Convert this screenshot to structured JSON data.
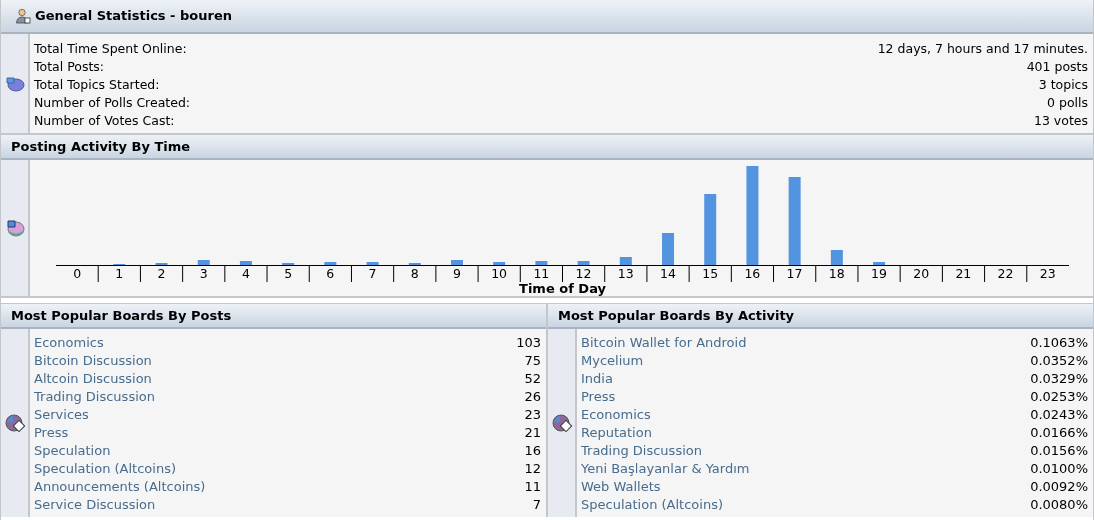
{
  "general": {
    "title": "General Statistics - bouren",
    "rows": [
      {
        "label": "Total Time Spent Online:",
        "value": "12 days, 7 hours and 17 minutes."
      },
      {
        "label": "Total Posts:",
        "value": "401 posts"
      },
      {
        "label": "Total Topics Started:",
        "value": "3 topics"
      },
      {
        "label": "Number of Polls Created:",
        "value": "0 polls"
      },
      {
        "label": "Number of Votes Cast:",
        "value": "13 votes"
      }
    ]
  },
  "activity": {
    "title": "Posting Activity By Time",
    "hours": [
      "0",
      "1",
      "2",
      "3",
      "4",
      "5",
      "6",
      "7",
      "8",
      "9",
      "10",
      "11",
      "12",
      "13",
      "14",
      "15",
      "16",
      "17",
      "18",
      "19",
      "20",
      "21",
      "22",
      "23"
    ],
    "xlabel": "Time of Day"
  },
  "boards_by_posts": {
    "title": "Most Popular Boards By Posts",
    "rows": [
      {
        "name": "Economics",
        "value": "103"
      },
      {
        "name": "Bitcoin Discussion",
        "value": "75"
      },
      {
        "name": "Altcoin Discussion",
        "value": "52"
      },
      {
        "name": "Trading Discussion",
        "value": "26"
      },
      {
        "name": "Services",
        "value": "23"
      },
      {
        "name": "Press",
        "value": "21"
      },
      {
        "name": "Speculation",
        "value": "16"
      },
      {
        "name": "Speculation (Altcoins)",
        "value": "12"
      },
      {
        "name": "Announcements (Altcoins)",
        "value": "11"
      },
      {
        "name": "Service Discussion",
        "value": "7"
      }
    ]
  },
  "boards_by_activity": {
    "title": "Most Popular Boards By Activity",
    "rows": [
      {
        "name": "Bitcoin Wallet for Android",
        "value": "0.1063%"
      },
      {
        "name": "Mycelium",
        "value": "0.0352%"
      },
      {
        "name": "India",
        "value": "0.0329%"
      },
      {
        "name": "Press",
        "value": "0.0253%"
      },
      {
        "name": "Economics",
        "value": "0.0243%"
      },
      {
        "name": "Reputation",
        "value": "0.0166%"
      },
      {
        "name": "Trading Discussion",
        "value": "0.0156%"
      },
      {
        "name": "Yeni Başlayanlar & Yardım",
        "value": "0.0100%"
      },
      {
        "name": "Web Wallets",
        "value": "0.0092%"
      },
      {
        "name": "Speculation (Altcoins)",
        "value": "0.0080%"
      }
    ]
  }
}
